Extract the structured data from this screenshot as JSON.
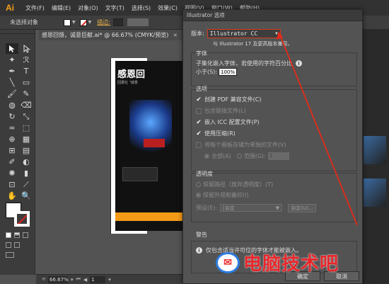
{
  "app": {
    "logo": "Ai"
  },
  "menu": [
    "文件(F)",
    "编辑(E)",
    "对象(O)",
    "文字(T)",
    "选择(S)",
    "效果(C)",
    "视图(V)",
    "窗口(W)",
    "帮助(H)"
  ],
  "control_bar": {
    "selection": "未选择对象",
    "stroke_label": "描边:"
  },
  "tab": {
    "title": "感恩回馈，诚意巨献.ai* @ 66.67% (CMYK/预览)",
    "close": "×"
  },
  "artwork": {
    "title": "感恩回",
    "subtitle": "回报社 \"诚意"
  },
  "status": {
    "zoom": "66.67%",
    "page": "1"
  },
  "dialog": {
    "title": "Illustrator 选项",
    "version_label": "版本:",
    "version_value": "Illustrator CC",
    "version_note": "与 Illustrator 17 及更高版本兼容。",
    "fonts": {
      "title": "字体",
      "subset_text": "子集化嵌入字体，若使用的字符百分比",
      "less_than_label": "小于(S):",
      "percent_value": "100%"
    },
    "options": {
      "title": "选项",
      "items": [
        {
          "label": "创建 PDF 兼容文件(C)",
          "checked": true,
          "enabled": true
        },
        {
          "label": "包含链接文件(L)",
          "checked": false,
          "enabled": false
        },
        {
          "label": "嵌入 ICC 配置文件(P)",
          "checked": true,
          "enabled": true
        },
        {
          "label": "使用压缩(R)",
          "checked": true,
          "enabled": true
        },
        {
          "label": "将每个画板存储为单独的文件(V)",
          "checked": false,
          "enabled": false
        }
      ],
      "all_label": "全部(A)",
      "range_label": "范围(G):",
      "range_value": "1"
    },
    "transparency": {
      "title": "透明度",
      "keep_paths": "保留路径（放弃透明度）(T)",
      "keep_appearance": "保留外观和叠印(I)",
      "preset_label": "预设(E):",
      "preset_value": "[自定",
      "custom_button": "自定(U)..."
    },
    "warning": {
      "title": "警告",
      "text": "仅包含适当许可位的字体才能被嵌入。"
    },
    "ok_button": "确定",
    "cancel_button": "取消"
  },
  "watermark": {
    "text": "电脑技术吧"
  },
  "colors": {
    "accent_red": "#d83a1c",
    "ai_orange": "#f7a01c",
    "watermark_red": "#e8262a"
  }
}
